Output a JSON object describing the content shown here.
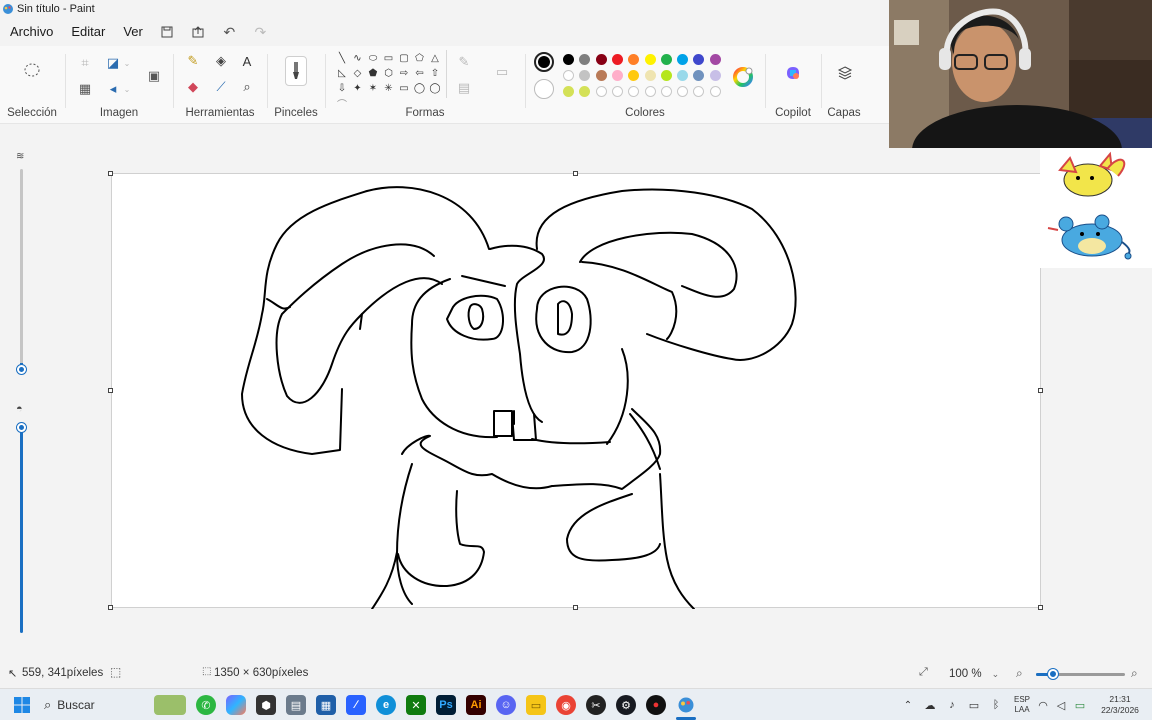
{
  "window": {
    "title": "Sin título - Paint"
  },
  "menu": {
    "file": "Archivo",
    "edit": "Editar",
    "view": "Ver"
  },
  "ribbon": {
    "selection": "Selección",
    "image": "Imagen",
    "tools": "Herramientas",
    "brushes": "Pinceles",
    "shapes": "Formas",
    "colors": "Colores",
    "copilot": "Copilot",
    "layers": "Capas"
  },
  "palette": {
    "primary": "#000000",
    "secondary": "#ffffff",
    "row1": [
      "#000000",
      "#7f7f7f",
      "#880015",
      "#ed1c24",
      "#ff7f27",
      "#fff200",
      "#22b14c",
      "#00a2e8",
      "#3f48cc",
      "#a349a4"
    ],
    "row2": [
      "#ffffff",
      "#c3c3c3",
      "#b97a57",
      "#ffaec9",
      "#ffc90e",
      "#efe4b0",
      "#b5e61d",
      "#99d9ea",
      "#7092be",
      "#c8bfe7"
    ],
    "row3": [
      "#d4e157",
      "#d4e157",
      "",
      "",
      "",
      "",
      "",
      "",
      "",
      ""
    ]
  },
  "status": {
    "cursor": "559, 341píxeles",
    "canvas_size": "1350 × 630píxeles",
    "zoom": "100 %",
    "zoom_level": 0.2
  },
  "taskbar": {
    "search": "Buscar",
    "lang_top": "ESP",
    "lang_bottom": "LAA",
    "time": "21:31",
    "date": "22/3/2026"
  }
}
